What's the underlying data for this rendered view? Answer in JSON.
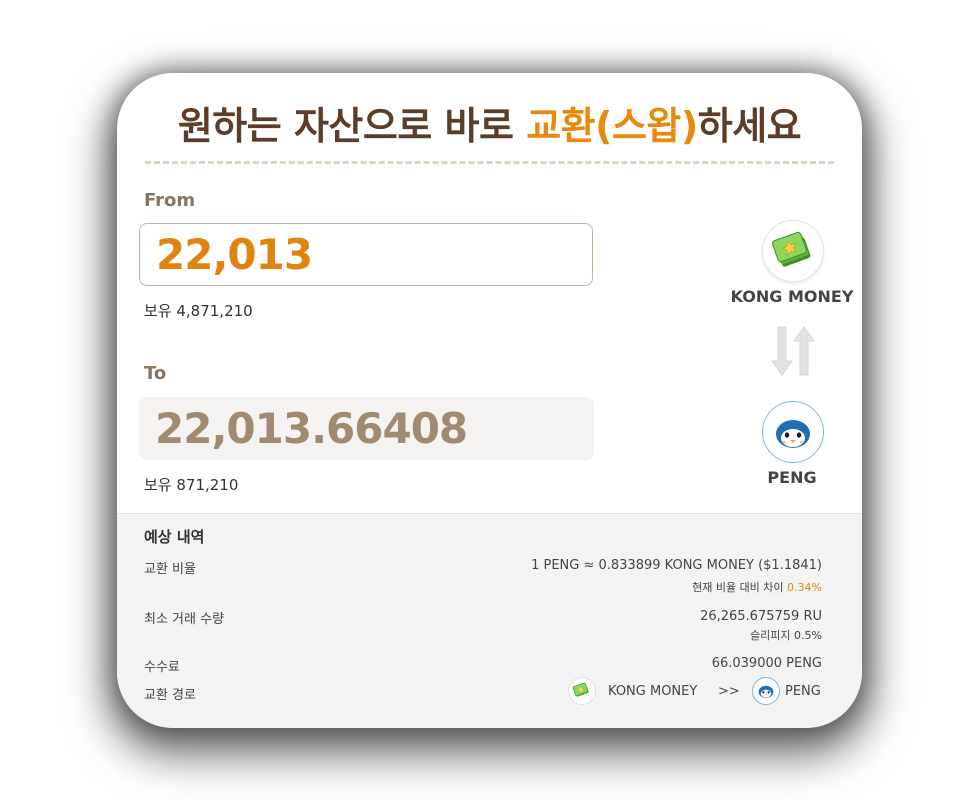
{
  "title": {
    "part1": "원하는 자산으로 바로 ",
    "accent": "교환(스왑)",
    "part2": "하세요"
  },
  "from": {
    "label": "From",
    "amount": "22,013",
    "balance": "보유 4,871,210",
    "token": "KONG MONEY",
    "icon": "money-stack-icon"
  },
  "to": {
    "label": "To",
    "amount": "22,013.66408",
    "balance": "보유 871,210",
    "token": "PENG",
    "icon": "penguin-icon"
  },
  "swap_icon": "swap-arrows-icon",
  "summary": {
    "title": "예상 내역",
    "rate": {
      "label": "교환 비율",
      "value": "1 PENG ≈ 0.833899 KONG MONEY ($1.1841)",
      "sub_prefix": "현재 비율 대비 차이 ",
      "sub_pct": "0.34%"
    },
    "min_amount": {
      "label": "최소 거래 수량",
      "value": "26,265.675759 RU",
      "sub": "슬리피지 0.5%"
    },
    "fee": {
      "label": "수수료",
      "value": "66.039000 PENG"
    },
    "route": {
      "label": "교환 경로",
      "from": "KONG MONEY",
      "sep": ">>",
      "to": "PENG"
    }
  },
  "colors": {
    "accent": "#e08410",
    "title_brown": "#5c3d29",
    "label_brown": "#8c7560",
    "to_value": "#a08a72"
  }
}
